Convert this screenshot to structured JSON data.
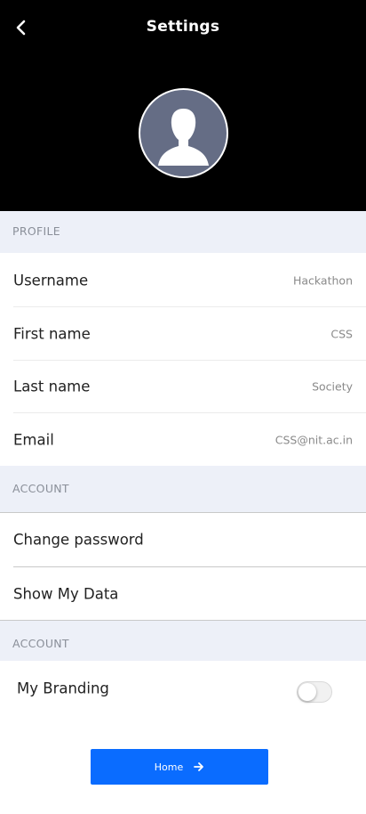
{
  "header": {
    "title": "Settings",
    "back_icon": "chevron-left-icon",
    "avatar_icon": "user-silhouette-icon",
    "background": "#000000"
  },
  "profile_section": {
    "heading": "PROFILE",
    "rows": [
      {
        "label": "Username",
        "value": "Hackathon"
      },
      {
        "label": "First name",
        "value": "CSS"
      },
      {
        "label": "Last name",
        "value": "Society"
      },
      {
        "label": "Email",
        "value": "CSS@nit.ac.in"
      }
    ]
  },
  "account_section": {
    "heading": "ACCOUNT",
    "rows": [
      {
        "label": "Change password"
      },
      {
        "label": "Show My Data"
      }
    ]
  },
  "account_section_2": {
    "heading": "ACCOUNT",
    "branding": {
      "label": "My Branding",
      "enabled": false
    }
  },
  "home_button": {
    "label": "Home",
    "icon": "arrow-right-icon",
    "color": "#0a6cff"
  },
  "colors": {
    "section_background": "#edf0f8",
    "section_text": "#8a8f99",
    "avatar_fill": "#656d85"
  }
}
